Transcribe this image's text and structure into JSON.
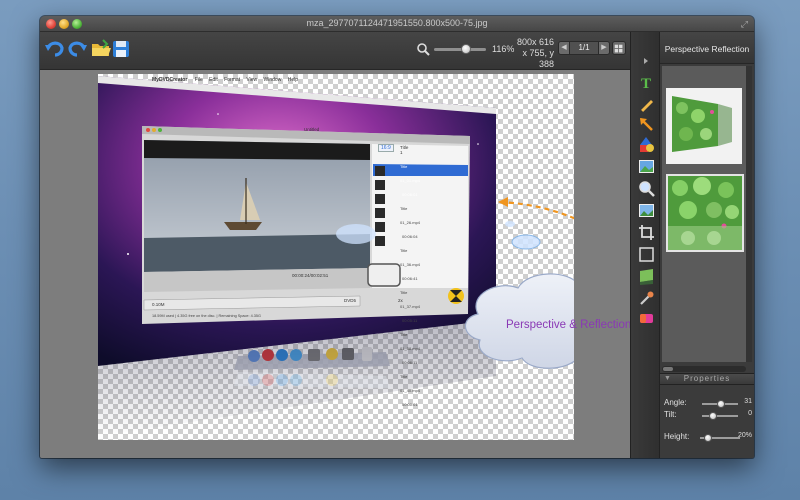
{
  "window": {
    "title": "mza_2977071124471951550.800x500-75.jpg"
  },
  "toolbar": {
    "zoom_percent": "116%",
    "zoom_fraction": 0.62,
    "image_size": "800x 616",
    "cursor_pos": "x 755, y 388",
    "page_label": "1/1"
  },
  "right_panel": {
    "tab_label": "Perspective  Reflection",
    "properties_title": "Properties",
    "props": [
      {
        "label": "Angle:",
        "value": "31",
        "fraction": 0.52
      },
      {
        "label": "Tilt:",
        "value": "0",
        "fraction": 0.3
      },
      {
        "label": "Height:",
        "value": "20%",
        "fraction": 0.2
      }
    ]
  },
  "callout": {
    "text": "Perspective & Reflection"
  },
  "screenshot": {
    "menu_items": [
      "MyDVDCreator",
      "File",
      "Edit",
      "Format",
      "View",
      "Window",
      "Help"
    ],
    "inner_title": "Untitled",
    "tab_label": "Title 1",
    "aspect_button": "16:9",
    "clip_names": [
      "Title 01_01.mp4",
      "Title 01_26.mp4",
      "Title 01_36.mp4",
      "Title 01_37.mp4",
      "Title 01_38.mp4",
      "Title 01_40.mp4"
    ],
    "clip_durations": [
      "00:06:01",
      "00:06:04",
      "00:06:41",
      "00:05:11",
      "00:06:11",
      "00:00:01"
    ],
    "timecode": "00:00:24/00:02:51",
    "progress_text": "0.10M",
    "status_text": "18.59M used | 4.35G free on the disc. | Remaining Space: 4.35G",
    "format_select": "DVD5",
    "speed_select": "2x"
  },
  "colors": {
    "accent_blue": "#2f6bd3",
    "callout_text": "#8a39b5",
    "callout_fill": "#dfe5f0",
    "arrow_orange": "#f0951f"
  }
}
